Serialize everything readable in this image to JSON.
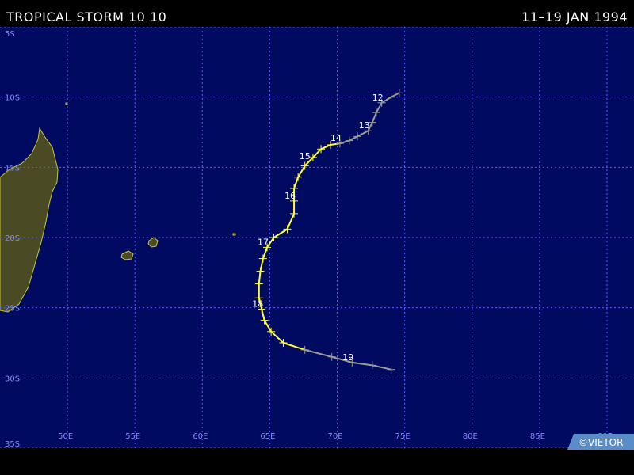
{
  "header": {
    "storm_name": "TROPICAL STORM 10 10",
    "dates": "11–19 JAN 1994"
  },
  "copyright": "©VIETOR",
  "colors": {
    "ocean": "#000a60",
    "grid": "#4a64ff",
    "land": "#4a4a24",
    "coast": "#c8c832",
    "track_storm": "#ffff33",
    "track_weak": "#9a9a9a"
  },
  "map": {
    "lon_range": [
      45,
      92
    ],
    "lat_range": [
      -5,
      -35
    ],
    "lat_labels": [
      {
        "lat": -5,
        "label": "5S"
      },
      {
        "lat": -10,
        "label": "10S"
      },
      {
        "lat": -15,
        "label": "15S"
      },
      {
        "lat": -20,
        "label": "20S"
      },
      {
        "lat": -25,
        "label": "25S"
      },
      {
        "lat": -30,
        "label": "30S"
      },
      {
        "lat": -35,
        "label": "35S"
      }
    ],
    "lon_labels": [
      {
        "lon": 50,
        "label": "50E"
      },
      {
        "lon": 55,
        "label": "55E"
      },
      {
        "lon": 60,
        "label": "60E"
      },
      {
        "lon": 65,
        "label": "65E"
      },
      {
        "lon": 70,
        "label": "70E"
      },
      {
        "lon": 75,
        "label": "75E"
      },
      {
        "lon": 80,
        "label": "80E"
      },
      {
        "lon": 85,
        "label": "85E"
      },
      {
        "lon": 90,
        "label": "90E"
      }
    ]
  },
  "track": {
    "points": [
      {
        "lon": 74.6,
        "lat": -9.7,
        "intensity": "weak"
      },
      {
        "lon": 74.0,
        "lat": -10.0,
        "intensity": "weak"
      },
      {
        "lon": 73.3,
        "lat": -10.4,
        "intensity": "weak"
      },
      {
        "lon": 72.9,
        "lat": -11.1,
        "intensity": "weak"
      },
      {
        "lon": 72.6,
        "lat": -11.8,
        "intensity": "weak"
      },
      {
        "lon": 72.3,
        "lat": -12.4,
        "intensity": "weak"
      },
      {
        "lon": 71.5,
        "lat": -12.8,
        "intensity": "weak"
      },
      {
        "lon": 70.9,
        "lat": -13.1,
        "intensity": "weak"
      },
      {
        "lon": 70.2,
        "lat": -13.3,
        "intensity": "weak"
      },
      {
        "lon": 69.5,
        "lat": -13.4,
        "intensity": "storm"
      },
      {
        "lon": 68.8,
        "lat": -13.7,
        "intensity": "storm"
      },
      {
        "lon": 68.2,
        "lat": -14.3,
        "intensity": "storm"
      },
      {
        "lon": 67.6,
        "lat": -14.9,
        "intensity": "storm"
      },
      {
        "lon": 67.1,
        "lat": -15.7,
        "intensity": "storm"
      },
      {
        "lon": 66.8,
        "lat": -16.5,
        "intensity": "storm"
      },
      {
        "lon": 66.8,
        "lat": -17.4,
        "intensity": "storm"
      },
      {
        "lon": 66.8,
        "lat": -18.3,
        "intensity": "storm"
      },
      {
        "lon": 66.3,
        "lat": -19.4,
        "intensity": "storm"
      },
      {
        "lon": 65.3,
        "lat": -20.0,
        "intensity": "storm"
      },
      {
        "lon": 64.8,
        "lat": -20.7,
        "intensity": "storm"
      },
      {
        "lon": 64.5,
        "lat": -21.5,
        "intensity": "storm"
      },
      {
        "lon": 64.3,
        "lat": -22.4,
        "intensity": "storm"
      },
      {
        "lon": 64.2,
        "lat": -23.3,
        "intensity": "storm"
      },
      {
        "lon": 64.2,
        "lat": -24.3,
        "intensity": "storm"
      },
      {
        "lon": 64.4,
        "lat": -25.1,
        "intensity": "storm"
      },
      {
        "lon": 64.6,
        "lat": -25.9,
        "intensity": "storm"
      },
      {
        "lon": 65.1,
        "lat": -26.7,
        "intensity": "storm"
      },
      {
        "lon": 66.0,
        "lat": -27.5,
        "intensity": "storm"
      },
      {
        "lon": 67.6,
        "lat": -28.0,
        "intensity": "weak"
      },
      {
        "lon": 69.6,
        "lat": -28.5,
        "intensity": "weak"
      },
      {
        "lon": 71.1,
        "lat": -28.9,
        "intensity": "weak"
      },
      {
        "lon": 72.6,
        "lat": -29.1,
        "intensity": "weak"
      },
      {
        "lon": 74.0,
        "lat": -29.4,
        "intensity": "weak"
      }
    ],
    "day_labels": [
      {
        "day": "12",
        "lon": 73.3,
        "lat": -10.4
      },
      {
        "day": "13",
        "lon": 72.3,
        "lat": -12.4
      },
      {
        "day": "14",
        "lon": 70.2,
        "lat": -13.3
      },
      {
        "day": "15",
        "lon": 67.9,
        "lat": -14.6
      },
      {
        "day": "16",
        "lon": 66.8,
        "lat": -17.4
      },
      {
        "day": "17",
        "lon": 64.8,
        "lat": -20.7
      },
      {
        "day": "18",
        "lon": 64.4,
        "lat": -25.1
      },
      {
        "day": "19",
        "lon": 71.1,
        "lat": -28.9
      }
    ]
  }
}
